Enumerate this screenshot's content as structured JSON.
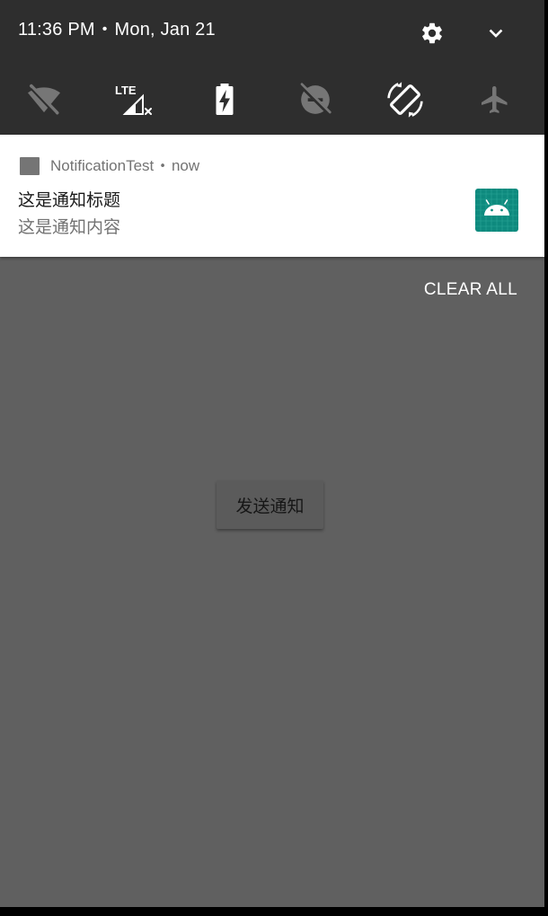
{
  "status_bar": {
    "time": "11:36 PM",
    "separator": "•",
    "date": "Mon, Jan 21"
  },
  "header_icons": {
    "settings": "gear-icon",
    "expand": "chevron-down-icon"
  },
  "quick_tiles": [
    {
      "name": "wifi-off-icon",
      "active": false
    },
    {
      "name": "cellular-lte-no-signal-icon",
      "label": "LTE",
      "active": true
    },
    {
      "name": "battery-charging-icon",
      "active": true
    },
    {
      "name": "do-not-disturb-off-icon",
      "active": false
    },
    {
      "name": "auto-rotate-icon",
      "active": true
    },
    {
      "name": "airplane-mode-icon",
      "active": false
    }
  ],
  "notification": {
    "app_name": "NotificationTest",
    "separator": "•",
    "time": "now",
    "title": "这是通知标题",
    "text": "这是通知内容",
    "large_icon": "android-icon",
    "large_icon_color": "#0e8a7e"
  },
  "clear_all_label": "CLEAR ALL",
  "app": {
    "send_button_label": "发送通知"
  },
  "colors": {
    "shade_background": "#2e2e2e",
    "scrim": "#606060",
    "notification_background": "#ffffff"
  }
}
